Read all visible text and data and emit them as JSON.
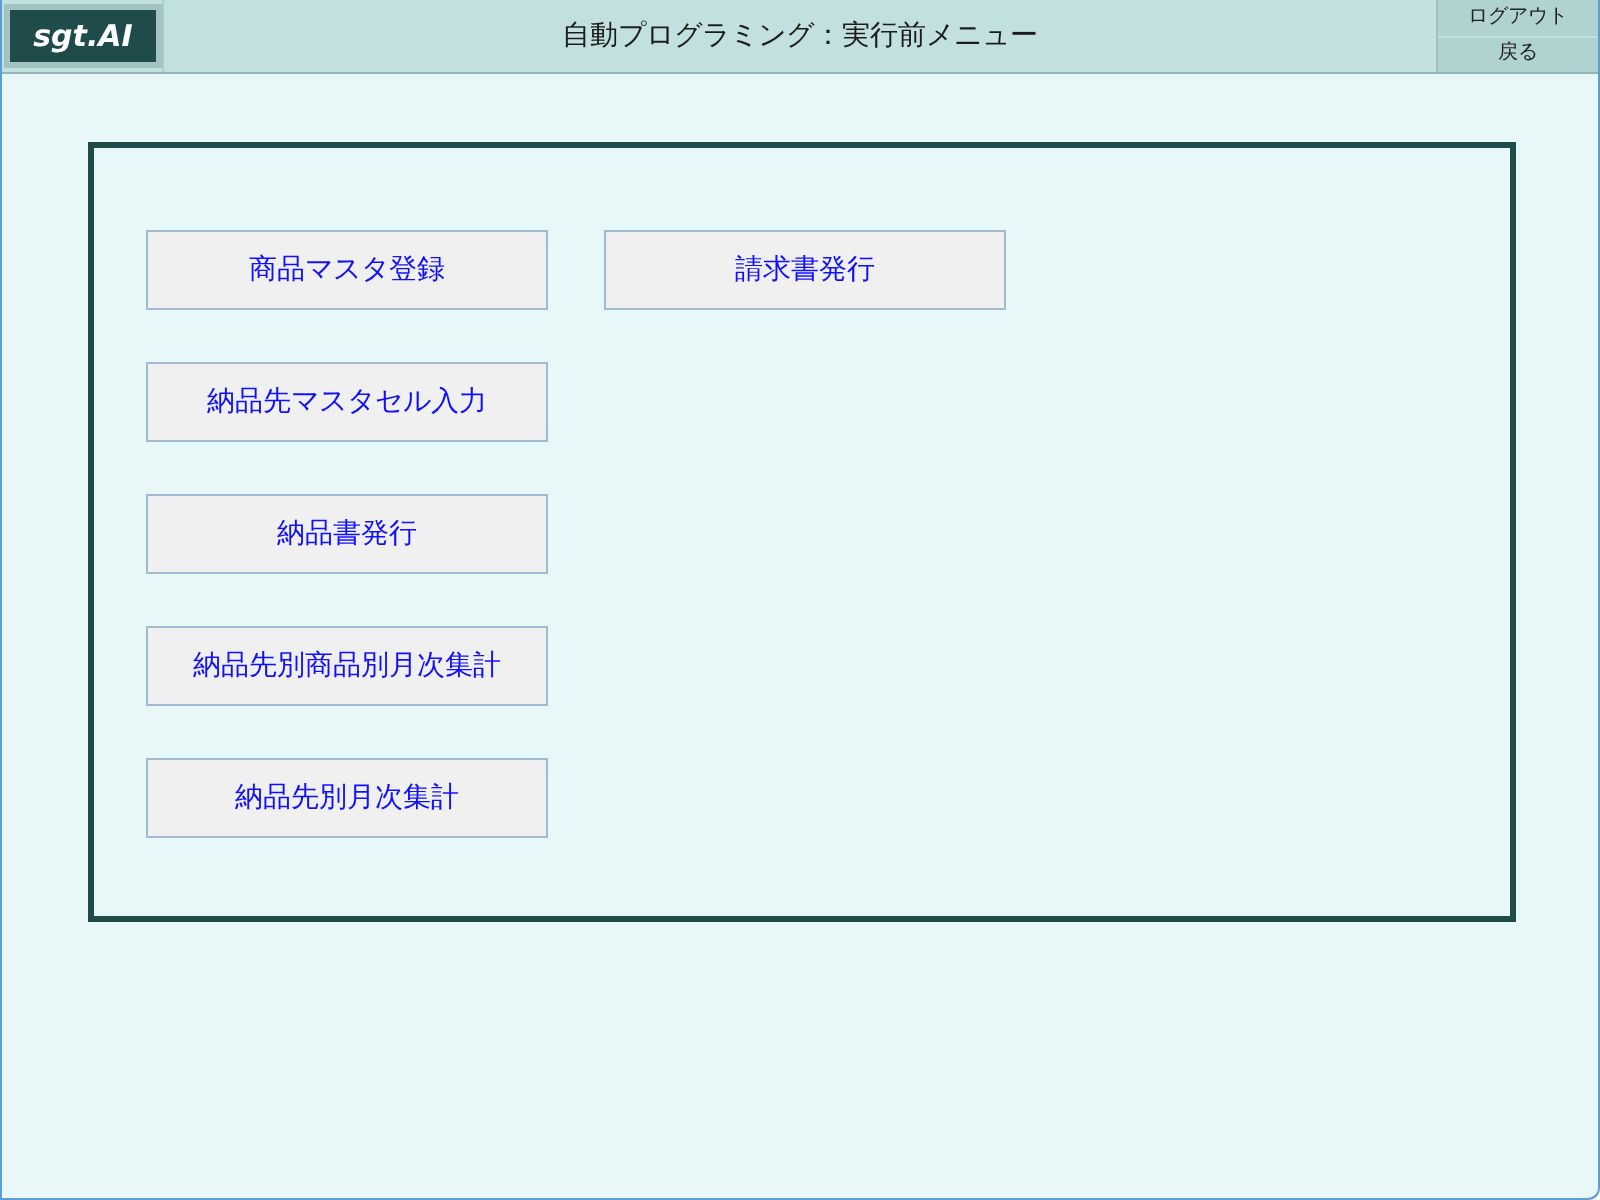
{
  "header": {
    "logo": "sgt.AI",
    "title": "自動プログラミング：実行前メニュー",
    "buttons": [
      "ログアウト",
      "戻る"
    ]
  },
  "menu": {
    "columns": [
      [
        "商品マスタ登録",
        "納品先マスタセル入力",
        "納品書発行",
        "納品先別商品別月次集計",
        "納品先別月次集計"
      ],
      [
        "請求書発行"
      ]
    ]
  }
}
